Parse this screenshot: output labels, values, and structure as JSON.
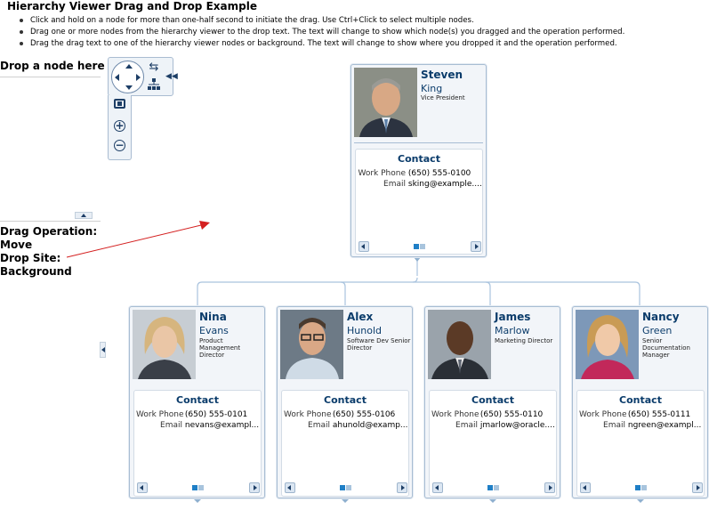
{
  "page": {
    "title": "Hierarchy Viewer Drag and Drop Example",
    "instructions": [
      "Click and hold on a node for more than one-half second to initiate the drag. Use Ctrl+Click to select multiple nodes.",
      "Drag one or more nodes from the hierarchy viewer to the drop text. The text will change to show which node(s) you dragged and the operation performed.",
      "Drag the drag text to one of the hierarchy viewer nodes or background. The text will change to show where you dropped it and the operation performed."
    ]
  },
  "drop_panel": {
    "label": "Drop a node here",
    "status_lines": [
      "Drag Operation:",
      "Move",
      "Drop Site:",
      "Background"
    ]
  },
  "controls": {
    "pan_icon": "pan-arrows-icon",
    "layout_icon": "swap-layout-icon",
    "hierarchy_icon": "hierarchy-icon",
    "fit_icon": "zoom-to-fit-icon",
    "zoom_in": "+",
    "zoom_out": "−"
  },
  "contact_heading": "Contact",
  "labels": {
    "work_phone": "Work Phone",
    "email": "Email"
  },
  "nodes": {
    "root": {
      "first": "Steven",
      "last": "King",
      "title": "Vice President",
      "phone": "(650) 555-0100",
      "email": "sking@example...."
    },
    "children": [
      {
        "first": "Nina",
        "last": "Evans",
        "title": "Product Management Director",
        "phone": "(650) 555-0101",
        "email": "nevans@exampl..."
      },
      {
        "first": "Alex",
        "last": "Hunold",
        "title": "Software Dev Senior Director",
        "phone": "(650) 555-0106",
        "email": "ahunold@examp..."
      },
      {
        "first": "James",
        "last": "Marlow",
        "title": "Marketing Director",
        "phone": "(650) 555-0110",
        "email": "jmarlow@oracle...."
      },
      {
        "first": "Nancy",
        "last": "Green",
        "title": "Senior Documentation Manager",
        "phone": "(650) 555-0111",
        "email": "ngreen@exampl..."
      }
    ]
  },
  "colors": {
    "accent": "#0b3c6b",
    "card_border": "#a8bdd3",
    "connector": "#a9c3de",
    "drag_line": "#d42020",
    "dot_active": "#1f7fc6"
  }
}
